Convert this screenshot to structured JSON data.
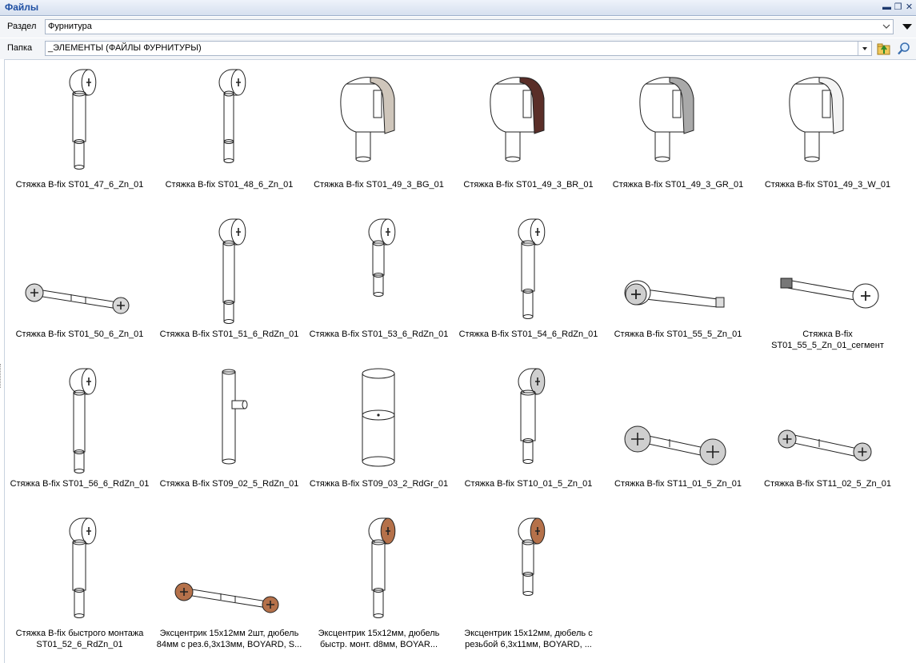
{
  "window": {
    "title": "Файлы",
    "controls": [
      "▬",
      "❐",
      "✕"
    ]
  },
  "section": {
    "label": "Раздел",
    "value": "Фурнитура"
  },
  "folder": {
    "label": "Папка",
    "value": "_ЭЛЕМЕНТЫ (ФАЙЛЫ ФУРНИТУРЫ)"
  },
  "icons": {
    "dropdown": "chevron-down-icon",
    "menu": "triangle-down-icon",
    "up": "folder-up-icon",
    "search": "search-icon"
  },
  "colors": {
    "title": "#1e4fa3",
    "beige": "#cfc6bb",
    "brown": "#5a2e28",
    "gray": "#a9a9a9",
    "white": "#f4f4f4",
    "copper": "#b5714a"
  },
  "items": [
    {
      "caption": [
        "Стяжка B-fix ST01_47_6_Zn_01"
      ],
      "shape": "vertical",
      "cap": "#ffffff"
    },
    {
      "caption": [
        "Стяжка B-fix ST01_48_6_Zn_01"
      ],
      "shape": "vertical-thin",
      "cap": "#ffffff"
    },
    {
      "caption": [
        "Стяжка B-fix ST01_49_3_BG_01"
      ],
      "shape": "clip",
      "cap": "#cfc6bb"
    },
    {
      "caption": [
        "Стяжка B-fix ST01_49_3_BR_01"
      ],
      "shape": "clip",
      "cap": "#5a2e28"
    },
    {
      "caption": [
        "Стяжка B-fix ST01_49_3_GR_01"
      ],
      "shape": "clip",
      "cap": "#a9a9a9"
    },
    {
      "caption": [
        "Стяжка B-fix ST01_49_3_W_01"
      ],
      "shape": "clip",
      "cap": "#f4f4f4"
    },
    {
      "caption": [
        "Стяжка B-fix ST01_50_6_Zn_01"
      ],
      "shape": "horizontal",
      "cap": "#d8d8d8"
    },
    {
      "caption": [
        "Стяжка B-fix ST01_51_6_RdZn_01"
      ],
      "shape": "vertical-long",
      "cap": "#ffffff"
    },
    {
      "caption": [
        "Стяжка B-fix ST01_53_6_RdZn_01"
      ],
      "shape": "vertical-short",
      "cap": "#ffffff"
    },
    {
      "caption": [
        "Стяжка B-fix ST01_54_6_RdZn_01"
      ],
      "shape": "vertical",
      "cap": "#ffffff"
    },
    {
      "caption": [
        "Стяжка B-fix ST01_55_5_Zn_01"
      ],
      "shape": "horizontal-right",
      "cap": "#cfcfcf"
    },
    {
      "caption": [
        "Стяжка B-fix",
        "ST01_55_5_Zn_01_сегмент"
      ],
      "shape": "horizontal-left",
      "cap": "#ffffff"
    },
    {
      "caption": [
        "Стяжка B-fix ST01_56_6_RdZn_01"
      ],
      "shape": "vertical-long",
      "cap": "#ffffff"
    },
    {
      "caption": [
        "Стяжка B-fix ST09_02_5_RdZn_01"
      ],
      "shape": "rod",
      "cap": "#ffffff"
    },
    {
      "caption": [
        "Стяжка B-fix ST09_03_2_RdGr_01"
      ],
      "shape": "cylinder",
      "cap": "#ffffff"
    },
    {
      "caption": [
        "Стяжка B-fix ST10_01_5_Zn_01"
      ],
      "shape": "vertical-gray",
      "cap": "#cfcfcf"
    },
    {
      "caption": [
        "Стяжка B-fix ST11_01_5_Zn_01"
      ],
      "shape": "double",
      "cap": "#cfcfcf"
    },
    {
      "caption": [
        "Стяжка B-fix ST11_02_5_Zn_01"
      ],
      "shape": "double-small",
      "cap": "#cfcfcf"
    },
    {
      "caption": [
        "Стяжка B-fix быстрого монтажа",
        "ST01_52_6_RdZn_01"
      ],
      "shape": "vertical",
      "cap": "#ffffff"
    },
    {
      "caption": [
        "Эксцентрик 15x12мм 2шт, дюбель",
        "84мм с рез.6,3x13мм, BOYARD, S..."
      ],
      "shape": "horizontal",
      "cap": "#b5714a"
    },
    {
      "caption": [
        "Эксцентрик 15x12мм, дюбель",
        "быстр. монт. d8мм, BOYAR..."
      ],
      "shape": "vertical",
      "cap": "#b5714a"
    },
    {
      "caption": [
        "Эксцентрик 15x12мм, дюбель с",
        "резьбой 6,3x11мм, BOYARD, ..."
      ],
      "shape": "vertical-short",
      "cap": "#b5714a"
    }
  ]
}
